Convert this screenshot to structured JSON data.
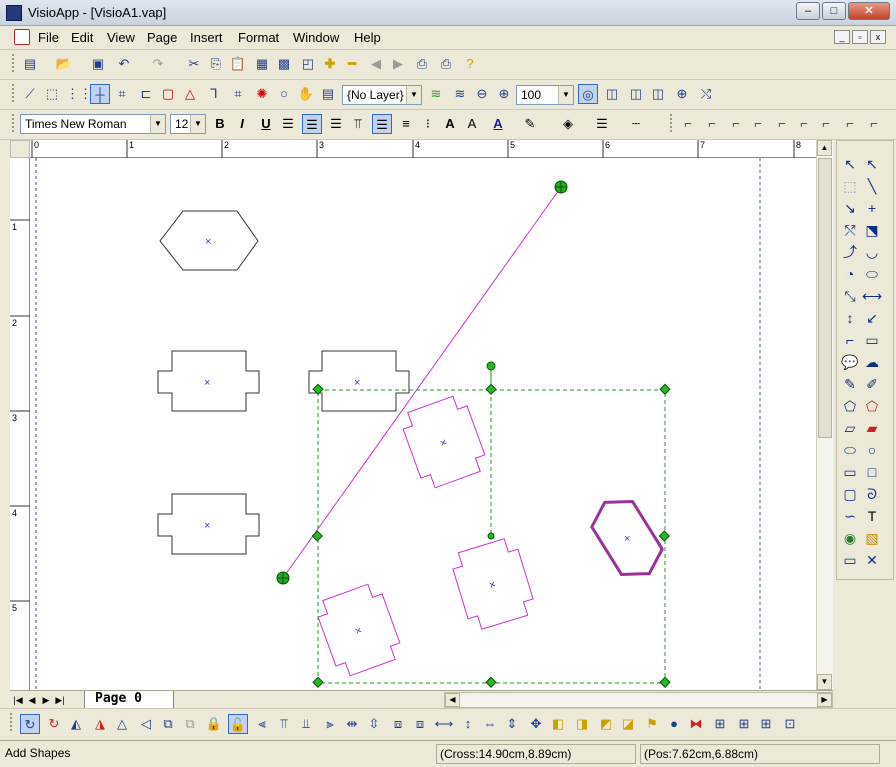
{
  "window": {
    "title": "VisioApp - [VisioA1.vap]",
    "min": "–",
    "max": "□",
    "close": "✕"
  },
  "menu": [
    "File",
    "Edit",
    "View",
    "Page",
    "Insert",
    "Format",
    "Window",
    "Help"
  ],
  "mdi_buttons": [
    "_",
    "▫",
    "x"
  ],
  "toolbar1": {
    "icons": [
      "new",
      "open",
      "save",
      "undo",
      "redo",
      "cut",
      "copy",
      "paste",
      "format-painter",
      "picture",
      "properties",
      "plus",
      "minus",
      "back",
      "forward",
      "print",
      "print-preview",
      "help"
    ]
  },
  "toolbar2": {
    "layer": "{No Layer}",
    "zoom": "100"
  },
  "format_toolbar": {
    "font": "Times New Roman",
    "size": "12",
    "bold": "B",
    "italic": "I",
    "underline": "U"
  },
  "ruler": {
    "h": [
      "0",
      "1",
      "2",
      "3",
      "4",
      "5",
      "6",
      "7",
      "8"
    ],
    "v": [
      "1",
      "2",
      "3",
      "4",
      "5"
    ]
  },
  "page_tab": "Page  0",
  "status": {
    "left": "Add Shapes",
    "cross": "(Cross:14.90cm,8.89cm)",
    "pos": "(Pos:7.62cm,6.88cm)"
  },
  "colors": {
    "selection": "#1aa01a",
    "line": "#cc33cc",
    "shape": "#333333",
    "accent": "#cc33cc"
  }
}
